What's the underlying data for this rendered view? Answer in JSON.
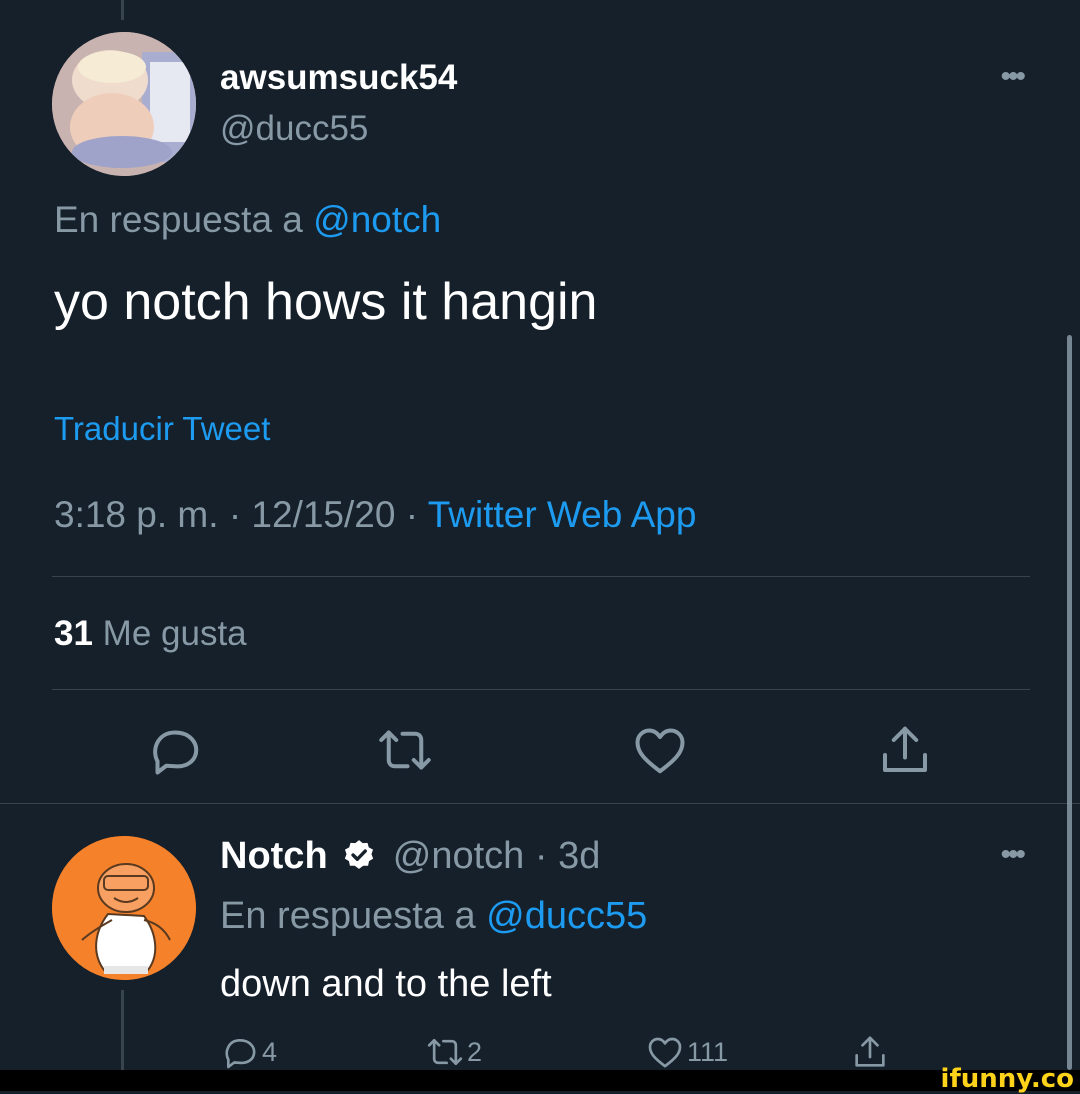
{
  "tweet": {
    "display_name": "awsumsuck54",
    "handle": "@ducc55",
    "reply_prefix": "En respuesta a",
    "reply_to": "@notch",
    "text": "yo notch hows it hangin",
    "translate": "Traducir Tweet",
    "time": "3:18 p. m.",
    "date": "12/15/20",
    "source": "Twitter Web App",
    "separator": "·",
    "likes_count": "31",
    "likes_label": "Me gusta",
    "more_icon": "more-horizontal-icon"
  },
  "reply": {
    "display_name": "Notch",
    "handle": "@notch",
    "age": "3d",
    "separator": "·",
    "reply_prefix": "En respuesta a",
    "reply_to": "@ducc55",
    "text": "down and to the left",
    "reply_count": "4",
    "retweet_count": "2",
    "like_count": "111"
  },
  "watermark": "ifunny.co",
  "colors": {
    "background": "#15202b",
    "accent": "#1d9bf0",
    "secondary_text": "#8899a6",
    "divider": "#38444d",
    "avatar_orange": "#f5812a"
  }
}
